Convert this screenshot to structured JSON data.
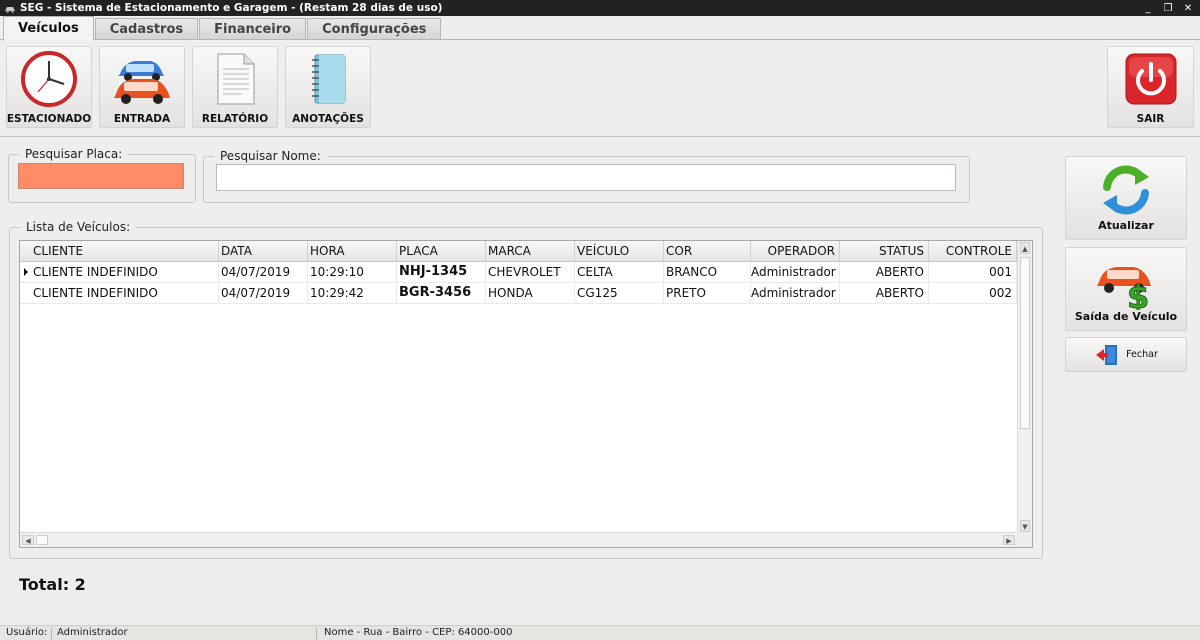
{
  "window": {
    "title": "SEG - Sistema de Estacionamento e Garagem  - (Restam 28 dias de uso)",
    "controls": [
      "_",
      "❐",
      "✕"
    ]
  },
  "tabs": [
    {
      "label": "Veículos",
      "active": true
    },
    {
      "label": "Cadastros",
      "active": false
    },
    {
      "label": "Financeiro",
      "active": false
    },
    {
      "label": "Configurações",
      "active": false
    }
  ],
  "ribbon": {
    "estacionado_label": "ESTACIONADO",
    "entrada_label": "ENTRADA",
    "relatorio_label": "RELATÓRIO",
    "anotacoes_label": "ANOTAÇÕES",
    "sair_label": "SAIR"
  },
  "search": {
    "placa_label": "Pesquisar Placa:",
    "placa_value": "",
    "nome_label": "Pesquisar Nome:",
    "nome_value": ""
  },
  "list": {
    "label": "Lista de Veículos:",
    "columns": [
      "CLIENTE",
      "DATA",
      "HORA",
      "PLACA",
      "MARCA",
      "VEÍCULO",
      "COR",
      "OPERADOR",
      "STATUS",
      "CONTROLE"
    ],
    "rows": [
      [
        "CLIENTE INDEFINIDO",
        "04/07/2019",
        "10:29:10",
        "NHJ-1345",
        "CHEVROLET",
        "CELTA",
        "BRANCO",
        "Administrador",
        "ABERTO",
        "001"
      ],
      [
        "CLIENTE INDEFINIDO",
        "04/07/2019",
        "10:29:42",
        "BGR-3456",
        "HONDA",
        "CG125",
        "PRETO",
        "Administrador",
        "ABERTO",
        "002"
      ]
    ]
  },
  "total_label": "Total: 2",
  "side": {
    "atualizar_label": "Atualizar",
    "saida_label": "Saída de Veículo",
    "fechar_label": "Fechar"
  },
  "status": {
    "usuario_label": "Usuário:",
    "usuario_value": "Administrador",
    "endereco": "Nome - Rua - Bairro - CEP: 64000-000"
  },
  "colors": {
    "placa_bg": "#ff8c66",
    "sair_red": "#d9262a",
    "atualizar_green": "#4caf2a",
    "atualizar_blue": "#2f8fd8"
  }
}
